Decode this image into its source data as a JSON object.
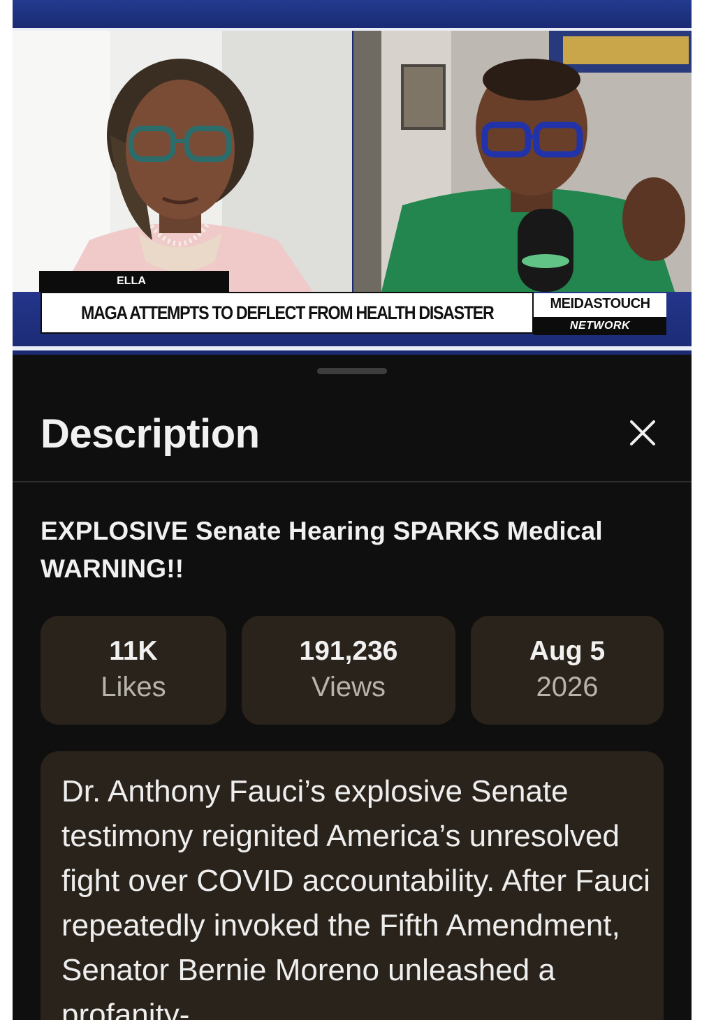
{
  "video": {
    "guest_name_tag": "ELLA",
    "headline": "MAGA ATTEMPTS TO DEFLECT FROM HEALTH DISASTER",
    "brand": "MEIDASTOUCH",
    "brand_sub": "NETWORK"
  },
  "sheet": {
    "title": "Description",
    "close_icon": "close-icon",
    "video_title": "EXPLOSIVE Senate Hearing SPARKS Medical WARNING!!",
    "stats": {
      "likes_value": "11K",
      "likes_label": "Likes",
      "views_value": "191,236",
      "views_label": "Views",
      "date_value": "Aug 5",
      "date_label": "2026"
    },
    "description": "Dr. Anthony Fauci’s explosive Senate testimony reignited America’s unresolved fight over COVID accountability. After Fauci repeatedly invoked the Fifth Amendment, Senator Bernie Moreno unleashed a profanity-"
  },
  "colors": {
    "sheet_bg": "#0f0f0f",
    "card_bg": "#2a231b",
    "text_primary": "#f1f1f1",
    "text_secondary": "#b8b3ad",
    "video_band": "#1d2d6e"
  }
}
